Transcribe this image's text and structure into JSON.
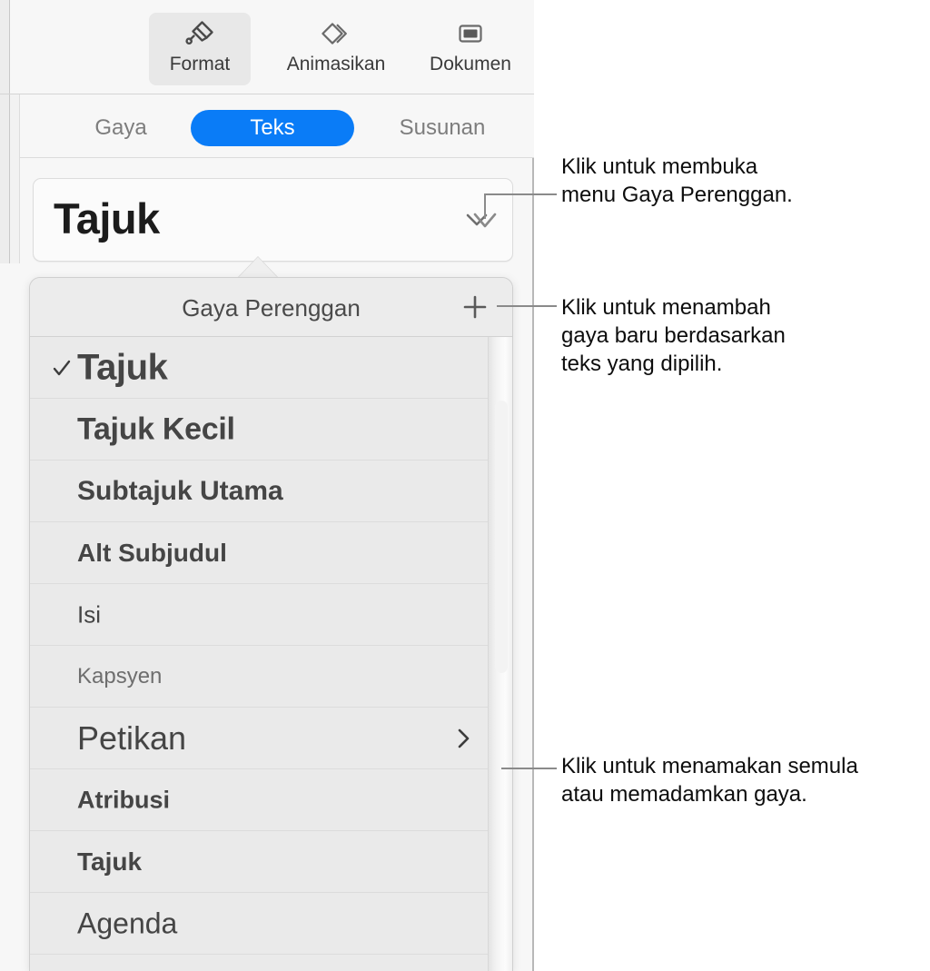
{
  "toolbar": {
    "buttons": [
      {
        "label": "Format",
        "icon": "paintbrush-icon",
        "active": true
      },
      {
        "label": "Animasikan",
        "icon": "animate-diamonds-icon",
        "active": false
      },
      {
        "label": "Dokumen",
        "icon": "document-frame-icon",
        "active": false
      }
    ]
  },
  "tabs": [
    {
      "label": "Gaya",
      "selected": false
    },
    {
      "label": "Teks",
      "selected": true
    },
    {
      "label": "Susunan",
      "selected": false
    }
  ],
  "style_field": {
    "value": "Tajuk",
    "chevron_icon": "chevron-down-icon"
  },
  "popup": {
    "title": "Gaya Perenggan",
    "add_button_icon": "plus-icon",
    "items": [
      {
        "label": "Tajuk",
        "checked": true,
        "submenu": false
      },
      {
        "label": "Tajuk Kecil",
        "checked": false,
        "submenu": false
      },
      {
        "label": "Subtajuk Utama",
        "checked": false,
        "submenu": false
      },
      {
        "label": "Alt Subjudul",
        "checked": false,
        "submenu": false
      },
      {
        "label": "Isi",
        "checked": false,
        "submenu": false
      },
      {
        "label": "Kapsyen",
        "checked": false,
        "submenu": false
      },
      {
        "label": "Petikan",
        "checked": false,
        "submenu": true
      },
      {
        "label": "Atribusi",
        "checked": false,
        "submenu": false
      },
      {
        "label": "Tajuk",
        "checked": false,
        "submenu": false
      },
      {
        "label": "Agenda",
        "checked": false,
        "submenu": false
      }
    ],
    "check_icon": "checkmark-icon",
    "submenu_icon": "chevron-right-icon"
  },
  "callouts": [
    {
      "text": "Klik untuk membuka\nmenu Gaya Perenggan."
    },
    {
      "text": "Klik untuk menambah\ngaya baru berdasarkan\nteks yang dipilih."
    },
    {
      "text": "Klik untuk menamakan semula\natau memadamkan gaya."
    }
  ],
  "colors": {
    "accent": "#0a7cf7",
    "panel_background": "#f7f7f7",
    "popup_background": "#eaeaea",
    "text": "#454545",
    "leader_line": "#8a8a8a"
  }
}
